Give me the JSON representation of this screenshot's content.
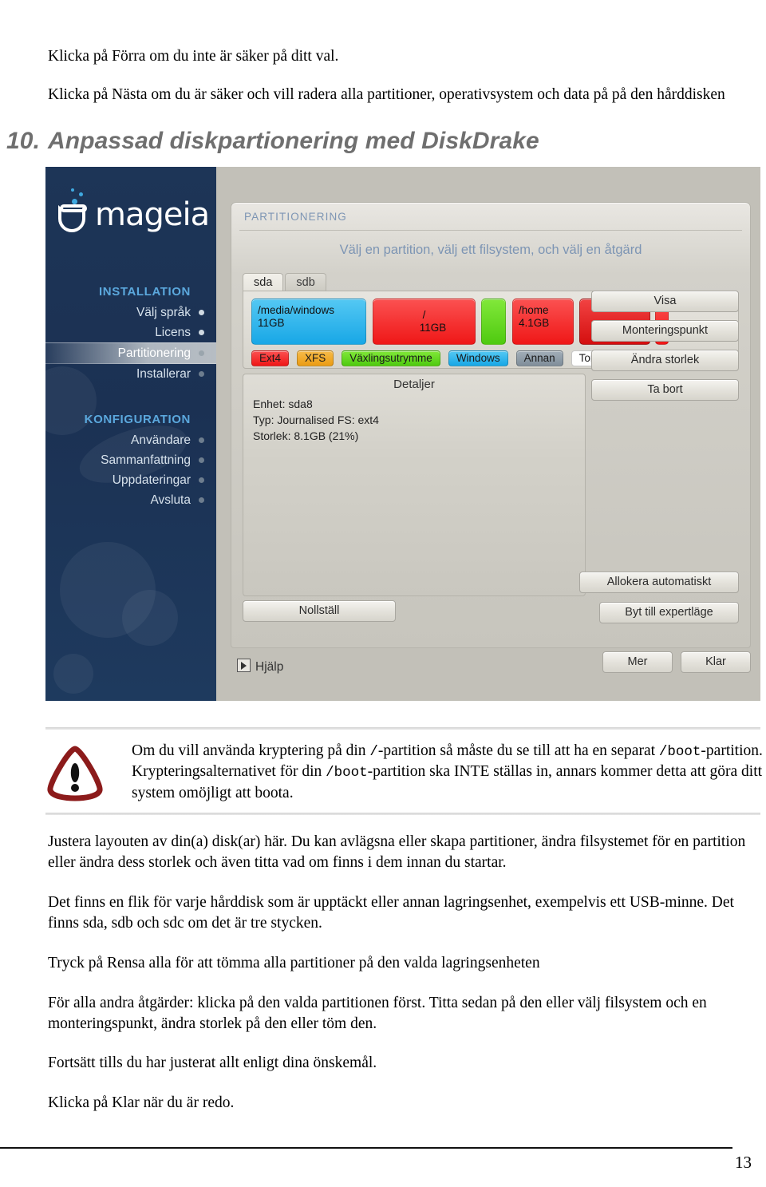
{
  "document": {
    "intro_paragraphs": [
      "Klicka på Förra om du inte är säker på ditt val.",
      "Klicka på Nästa om du är säker och vill radera alla partitioner, operativsystem och data på på den hårddisken"
    ],
    "section_number": "10.",
    "section_title": "Anpassad diskpartionering med DiskDrake",
    "page_number": "13"
  },
  "screenshot": {
    "brand": {
      "logo_text": "mageia",
      "cauldron_icon": "mageia-cauldron-icon"
    },
    "sidebar": {
      "groups": [
        {
          "label": "INSTALLATION",
          "items": [
            {
              "label": "Välj språk",
              "state": "done"
            },
            {
              "label": "Licens",
              "state": "done"
            },
            {
              "label": "Partitionering",
              "state": "current"
            },
            {
              "label": "Installerar",
              "state": "pending"
            }
          ]
        },
        {
          "label": "KONFIGURATION",
          "items": [
            {
              "label": "Användare",
              "state": "pending"
            },
            {
              "label": "Sammanfattning",
              "state": "pending"
            },
            {
              "label": "Uppdateringar",
              "state": "pending"
            },
            {
              "label": "Avsluta",
              "state": "pending"
            }
          ]
        }
      ]
    },
    "panel": {
      "title": "PARTITIONERING",
      "subtitle": "Välj en partition, välj ett filsystem, och välj en åtgärd",
      "tabs": [
        {
          "label": "sda",
          "active": true
        },
        {
          "label": "sdb",
          "active": false
        }
      ],
      "partitions": [
        {
          "mount": "/media/windows",
          "size": "11GB",
          "color": "#2eb3ec",
          "kind": "Windows",
          "align": "left"
        },
        {
          "mount": "/",
          "size": "11GB",
          "color": "#f42626",
          "kind": "Ext4",
          "align": "center"
        },
        {
          "mount": "",
          "size": "",
          "color": "#63d61b",
          "kind": "Växlingsutrymme",
          "align": "center"
        },
        {
          "mount": "/home",
          "size": "4.1GB",
          "color": "#f42626",
          "kind": "Ext4",
          "align": "left"
        },
        {
          "mount": "",
          "size": "",
          "color": "#e01c1c",
          "kind": "Ext4",
          "align": "center",
          "selected": true
        },
        {
          "mount": "",
          "size": "",
          "color": "#f42626",
          "kind": "Ext4",
          "align": "center"
        }
      ],
      "legend": [
        {
          "label": "Ext4",
          "color": "#f42626",
          "text_color": "#1a1a1a"
        },
        {
          "label": "XFS",
          "color": "#f0a82a",
          "text_color": "#1a1a1a"
        },
        {
          "label": "Växlingsutrymme",
          "color": "#63d61b",
          "text_color": "#1a1a1a"
        },
        {
          "label": "Windows",
          "color": "#2eb3ec",
          "text_color": "#1a1a1a"
        },
        {
          "label": "Annan",
          "color": "#8e9aa5",
          "text_color": "#1a1a1a"
        },
        {
          "label": "Tom",
          "color": "#ffffff",
          "text_color": "#1a1a1a"
        }
      ],
      "details": {
        "label": "Detaljer",
        "lines": [
          "Enhet: sda8",
          "Typ: Journalised FS: ext4",
          "Storlek: 8.1GB (21%)"
        ]
      },
      "action_buttons": [
        "Visa",
        "Monteringspunkt",
        "Ändra storlek",
        "Ta bort"
      ],
      "reset_button": "Nollställ",
      "allocate_button": "Allokera automatiskt",
      "expert_button": "Byt till expertläge",
      "help_label": "Hjälp",
      "help_icon": "expand-triangle-icon",
      "footer_buttons": [
        "Mer",
        "Klar"
      ],
      "cursor_icon": "mouse-pointer-icon"
    },
    "colors": {
      "sidebar_bg": "#1d3557",
      "group_label": "#5ba8dd",
      "panel_title": "#7d95b4",
      "panel_bg": "#c2c0b8"
    }
  },
  "note": {
    "icon": "warning-triangle-icon",
    "segments": [
      {
        "text": "Om du vill använda kryptering på din ",
        "mono": false
      },
      {
        "text": "/",
        "mono": true
      },
      {
        "text": "-partition så måste du se till att ha en separat ",
        "mono": false
      },
      {
        "text": "/boot",
        "mono": true
      },
      {
        "text": "-partition. Krypteringsalternativet för din ",
        "mono": false
      },
      {
        "text": "/boot",
        "mono": true
      },
      {
        "text": "-partition ska INTE ställas in, annars kommer detta att göra ditt system omöjligt att boota.",
        "mono": false
      }
    ]
  },
  "body": {
    "paragraphs": [
      "Justera layouten av din(a) disk(ar) här. Du kan avlägsna eller skapa partitioner, ändra filsystemet för en partition eller ändra dess storlek och även titta vad om finns i dem innan du startar.",
      "Det finns en flik för varje hårddisk som är upptäckt eller annan lagringsenhet, exempelvis ett USB-minne. Det finns sda, sdb och sdc om det är tre stycken.",
      "Tryck på Rensa alla för att tömma alla partitioner på den valda lagringsenheten",
      "För alla andra åtgärder: klicka på den valda partitionen först. Titta sedan på den eller välj filsystem och en monteringspunkt, ändra storlek på den eller töm den.",
      "Fortsätt tills du har justerat allt enligt dina önskemål.",
      "Klicka på Klar när du är redo."
    ]
  }
}
